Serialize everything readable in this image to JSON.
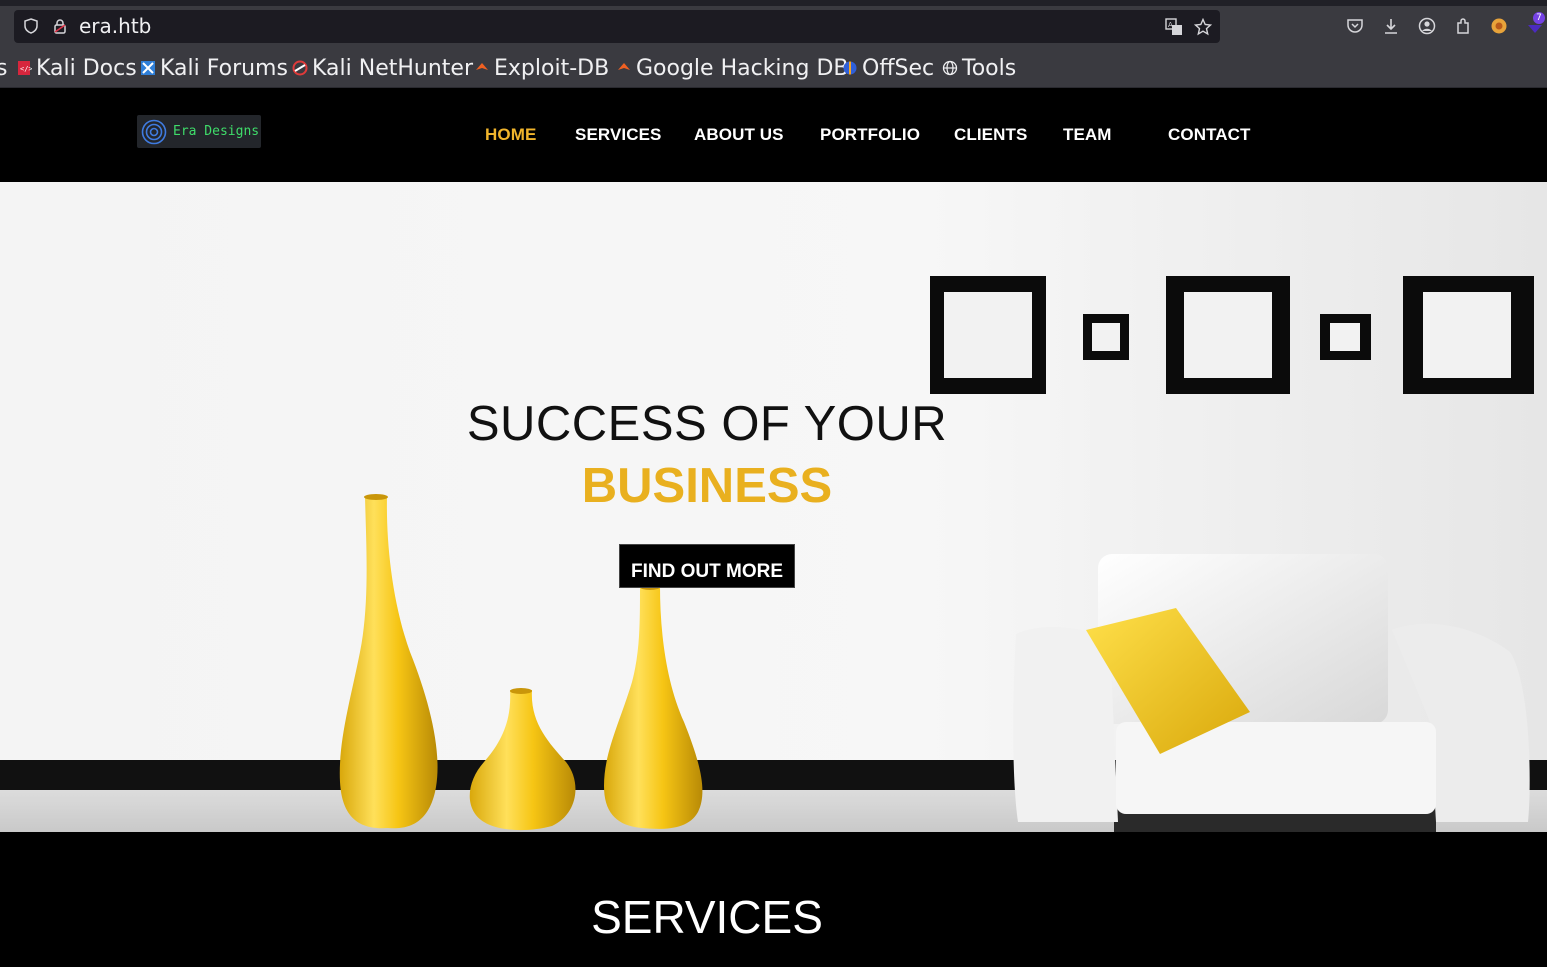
{
  "browser": {
    "url": "era.htb",
    "badge_count": "7",
    "bookmarks": [
      {
        "label": "s"
      },
      {
        "label": "Kali Docs"
      },
      {
        "label": "Kali Forums"
      },
      {
        "label": "Kali NetHunter"
      },
      {
        "label": "Exploit-DB"
      },
      {
        "label": "Google Hacking DB"
      },
      {
        "label": "OffSec"
      },
      {
        "label": "Tools"
      }
    ]
  },
  "site": {
    "logo_text": "Era Designs",
    "nav": [
      {
        "label": "HOME",
        "active": true
      },
      {
        "label": "SERVICES"
      },
      {
        "label": "ABOUT US"
      },
      {
        "label": "PORTFOLIO"
      },
      {
        "label": "CLIENTS"
      },
      {
        "label": "TEAM"
      },
      {
        "label": "CONTACT"
      }
    ],
    "accent_color": "#f1b52c"
  },
  "hero": {
    "title_line1": "SUCCESS OF YOUR",
    "title_line2": "BUSINESS",
    "button_label": "FIND OUT MORE"
  },
  "services": {
    "title": "SERVICES"
  }
}
